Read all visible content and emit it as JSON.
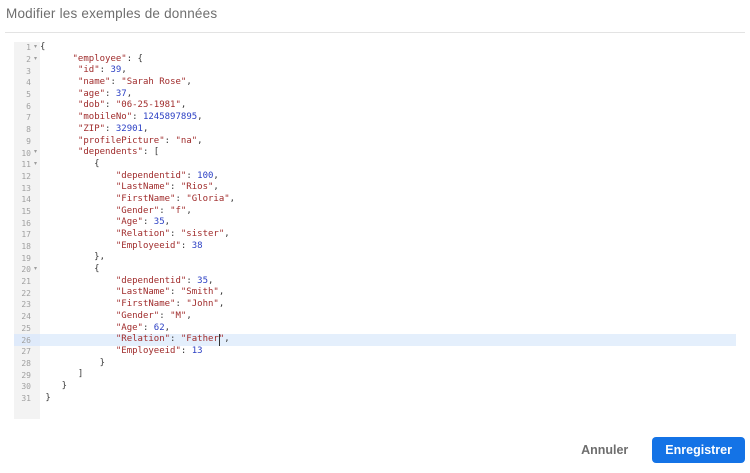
{
  "dialog": {
    "title": "Modifier les exemples de données"
  },
  "editor": {
    "language": "json",
    "total_lines": 31,
    "active_line": 26,
    "cursor": {
      "line": 26,
      "col": 33
    },
    "fold_lines": [
      1,
      2,
      10,
      11,
      20
    ],
    "lines": [
      "{",
      "      \"employee\": {",
      "       \"id\": 39,",
      "       \"name\": \"Sarah Rose\",",
      "       \"age\": 37,",
      "       \"dob\": \"06-25-1981\",",
      "       \"mobileNo\": 1245897895,",
      "       \"ZIP\": 32901,",
      "       \"profilePicture\": \"na\",",
      "       \"dependents\": [",
      "          {",
      "              \"dependentid\": 100,",
      "              \"LastName\": \"Rios\",",
      "              \"FirstName\": \"Gloria\",",
      "              \"Gender\": \"f\",",
      "              \"Age\": 35,",
      "              \"Relation\": \"sister\",",
      "              \"Employeeid\": 38",
      "          },",
      "          {",
      "              \"dependentid\": 35,",
      "              \"LastName\": \"Smith\",",
      "              \"FirstName\": \"John\",",
      "              \"Gender\": \"M\",",
      "              \"Age\": 62,",
      "              \"Relation\": \"Father\",",
      "              \"Employeeid\": 13",
      "           }",
      "       ]",
      "    }",
      " }"
    ]
  },
  "footer": {
    "cancel_label": "Annuler",
    "save_label": "Enregistrer"
  },
  "colors": {
    "accent": "#1473e6",
    "string_token": "#a02c2c",
    "number_token": "#2b3fc4",
    "active_line_bg": "#e4effc",
    "gutter_bg": "#f3f3f3",
    "gutter_text": "#a0a0a0"
  }
}
